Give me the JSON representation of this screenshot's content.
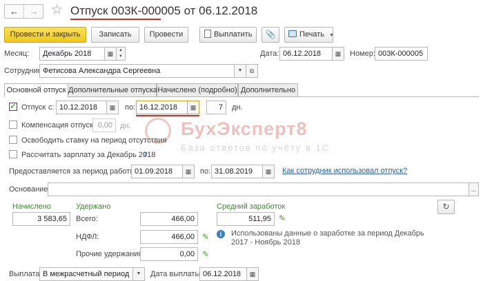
{
  "window": {
    "title": "Отпуск 003К-000005 от 06.12.2018"
  },
  "toolbar": {
    "post_close": "Провести и закрыть",
    "save": "Записать",
    "post": "Провести",
    "pay": "Выплатить",
    "print": "Печать"
  },
  "header": {
    "month_label": "Месяц:",
    "month_value": "Декабрь 2018",
    "date_label": "Дата:",
    "date_value": "06.12.2018",
    "number_label": "Номер:",
    "number_value": "003К-000005",
    "employee_label": "Сотрудник:",
    "employee_value": "Фетисова Александра Сергеевна"
  },
  "tabs": [
    "Основной отпуск",
    "Дополнительные отпуска",
    "Начислено (подробно)",
    "Дополнительно"
  ],
  "leave": {
    "checkbox_label": "Отпуск",
    "from_label": "с:",
    "from_value": "10.12.2018",
    "to_label": "по:",
    "to_value": "16.12.2018",
    "days_value": "7",
    "days_label": "дн.",
    "compensation_label": "Компенсация отпуска",
    "compensation_value": "0,00",
    "compensation_unit": "дн.",
    "free_rate_label": "Освободить ставку на период отсутствия",
    "calc_salary_label": "Рассчитать зарплату за Декабрь 2018",
    "help_mark": "?",
    "period_label": "Предоставляется за период работы с:",
    "period_from": "01.09.2018",
    "period_to_label": "по:",
    "period_to": "31.08.2019",
    "usage_link": "Как сотрудник использовал отпуск?",
    "basis_label": "Основание:",
    "basis_value": ""
  },
  "watermark": {
    "title": "БухЭксперт8",
    "subtitle": "База ответов по учёту в 1С"
  },
  "totals": {
    "accrued_label": "Начислено",
    "accrued_value": "3 583,65",
    "withheld_label": "Удержано",
    "total_label": "Всего:",
    "total_value": "466,00",
    "ndfl_label": "НДФЛ:",
    "ndfl_value": "466,00",
    "other_label": "Прочие удержания:",
    "other_value": "0,00",
    "avg_label": "Средний заработок",
    "avg_value": "511,95",
    "info_text": "Использованы данные о заработке за период Декабрь 2017 - Ноябрь 2018"
  },
  "payment": {
    "label": "Выплата:",
    "value": "В межрасчетный период",
    "date_label": "Дата выплаты:",
    "date_value": "06.12.2018"
  },
  "colors": {
    "primary_button": "#f5d22e",
    "underline": "#d92a1c",
    "label_green": "#3d8a2e",
    "link": "#2a5bb8"
  }
}
